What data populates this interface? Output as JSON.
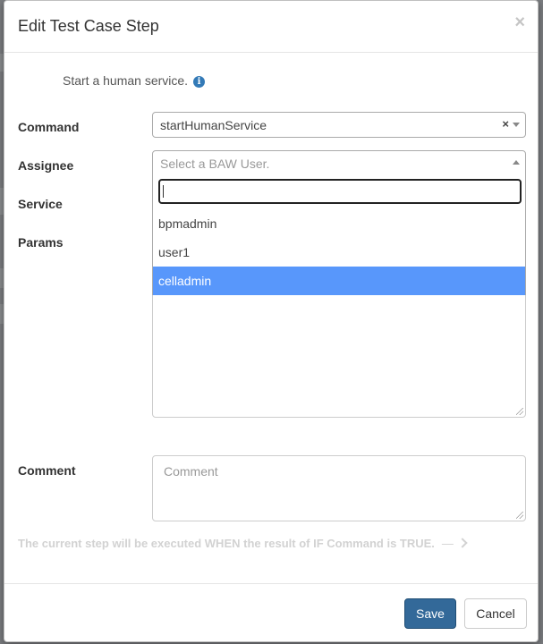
{
  "modal": {
    "title": "Edit Test Case Step",
    "close_glyph": "×"
  },
  "hint": {
    "text": "Start a human service.",
    "icon": "info-icon",
    "icon_glyph": "i"
  },
  "fields": {
    "command": {
      "label": "Command",
      "value": "startHumanService",
      "clear_glyph": "×"
    },
    "assignee": {
      "label": "Assignee",
      "placeholder": "Select a BAW User.",
      "search_value": "",
      "options": [
        "bpmadmin",
        "user1",
        "celladmin"
      ],
      "highlighted": "celladmin"
    },
    "service": {
      "label": "Service"
    },
    "params": {
      "label": "Params"
    },
    "comment": {
      "label": "Comment",
      "placeholder": "Comment"
    }
  },
  "note": {
    "text": "The current step will be executed WHEN the result of IF Command is TRUE.",
    "dash": "—"
  },
  "footer": {
    "save_label": "Save",
    "cancel_label": "Cancel"
  },
  "colors": {
    "primary": "#336999",
    "highlight": "#5897fb",
    "info": "#337ab7"
  }
}
